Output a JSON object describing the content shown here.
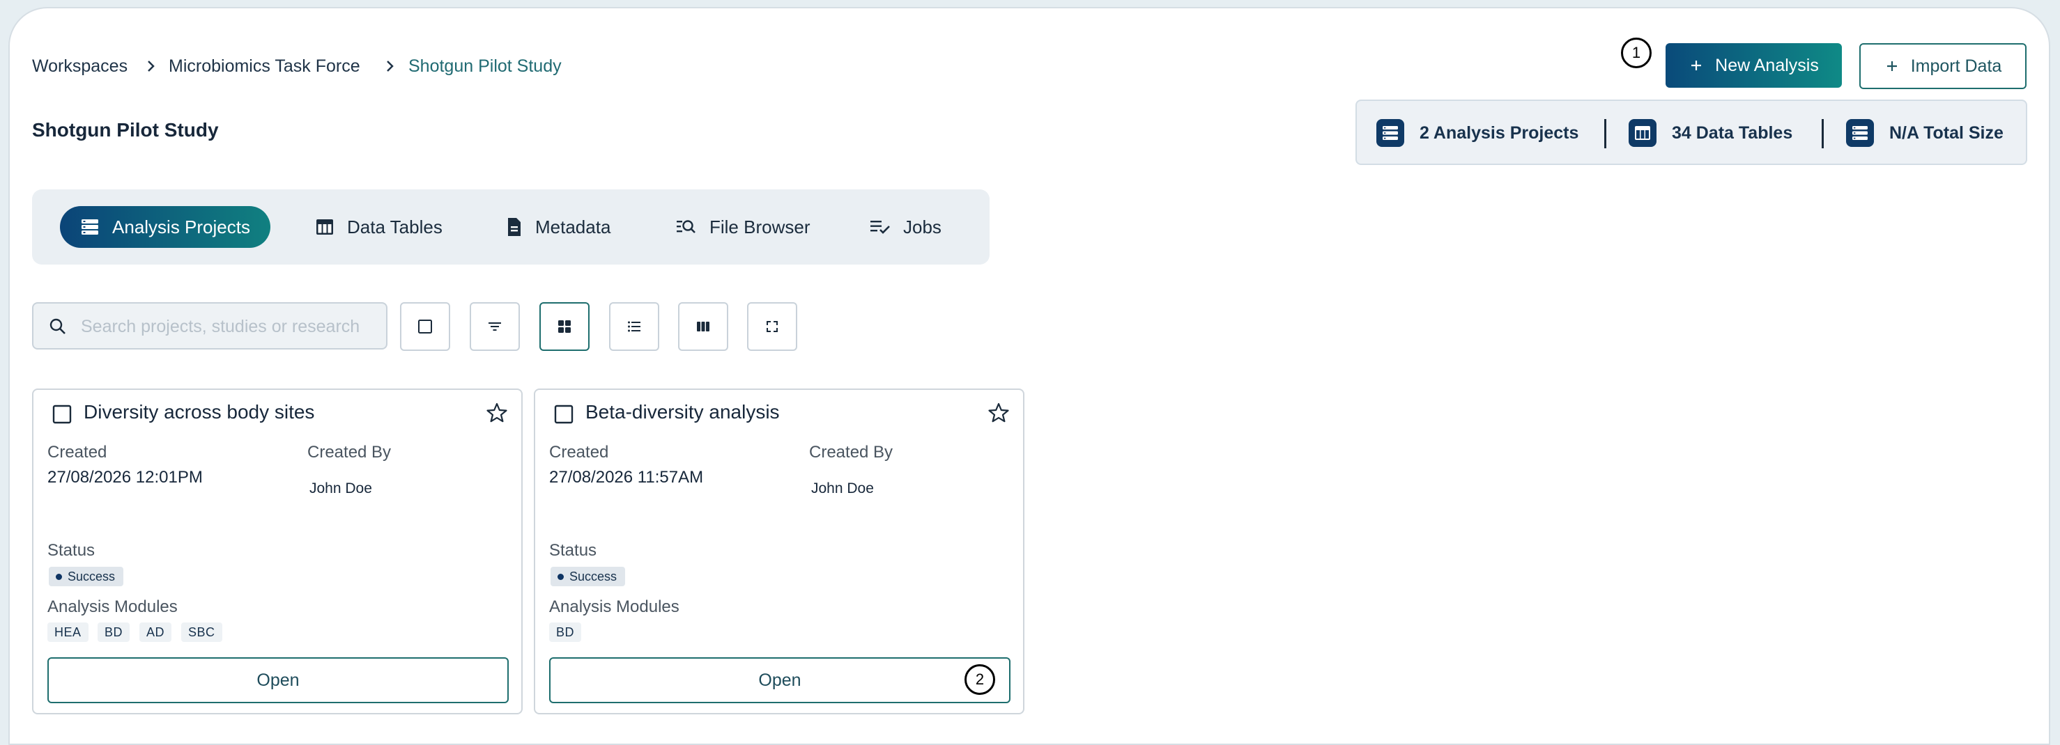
{
  "breadcrumb": {
    "items": [
      "Workspaces",
      "Microbiomics Task Force",
      "Shotgun Pilot Study"
    ]
  },
  "page_title": "Shotgun Pilot Study",
  "header_actions": {
    "new_analysis_label": "New Analysis",
    "import_data_label": "Import Data",
    "marker_1": "1"
  },
  "stats": {
    "analysis_projects": "2 Analysis Projects",
    "data_tables": "34 Data Tables",
    "total_size": "N/A Total Size"
  },
  "tabs": [
    {
      "label": "Analysis Projects",
      "icon": "stack-icon",
      "active": true
    },
    {
      "label": "Data Tables",
      "icon": "table-icon"
    },
    {
      "label": "Metadata",
      "icon": "document-icon"
    },
    {
      "label": "File Browser",
      "icon": "search-list-icon"
    },
    {
      "label": "Jobs",
      "icon": "checklist-icon"
    }
  ],
  "toolbar": {
    "search_placeholder": "Search projects, studies or research"
  },
  "cards": [
    {
      "title": "Diversity across body sites",
      "created_label": "Created",
      "created_value": "27/08/2026 12:01PM",
      "created_by_label": "Created By",
      "created_by_value": "John Doe",
      "status_label": "Status",
      "status_value": "Success",
      "modules_label": "Analysis Modules",
      "modules": [
        "HEA",
        "BD",
        "AD",
        "SBC"
      ],
      "open_label": "Open"
    },
    {
      "title": "Beta-diversity analysis",
      "created_label": "Created",
      "created_value": "27/08/2026 11:57AM",
      "created_by_label": "Created By",
      "created_by_value": "John Doe",
      "status_label": "Status",
      "status_value": "Success",
      "modules_label": "Analysis Modules",
      "modules": [
        "BD"
      ],
      "open_label": "Open",
      "marker": "2"
    }
  ],
  "colors": {
    "accent_start": "#0b4478",
    "accent_end": "#108080",
    "border_teal": "#1e6e6e"
  }
}
